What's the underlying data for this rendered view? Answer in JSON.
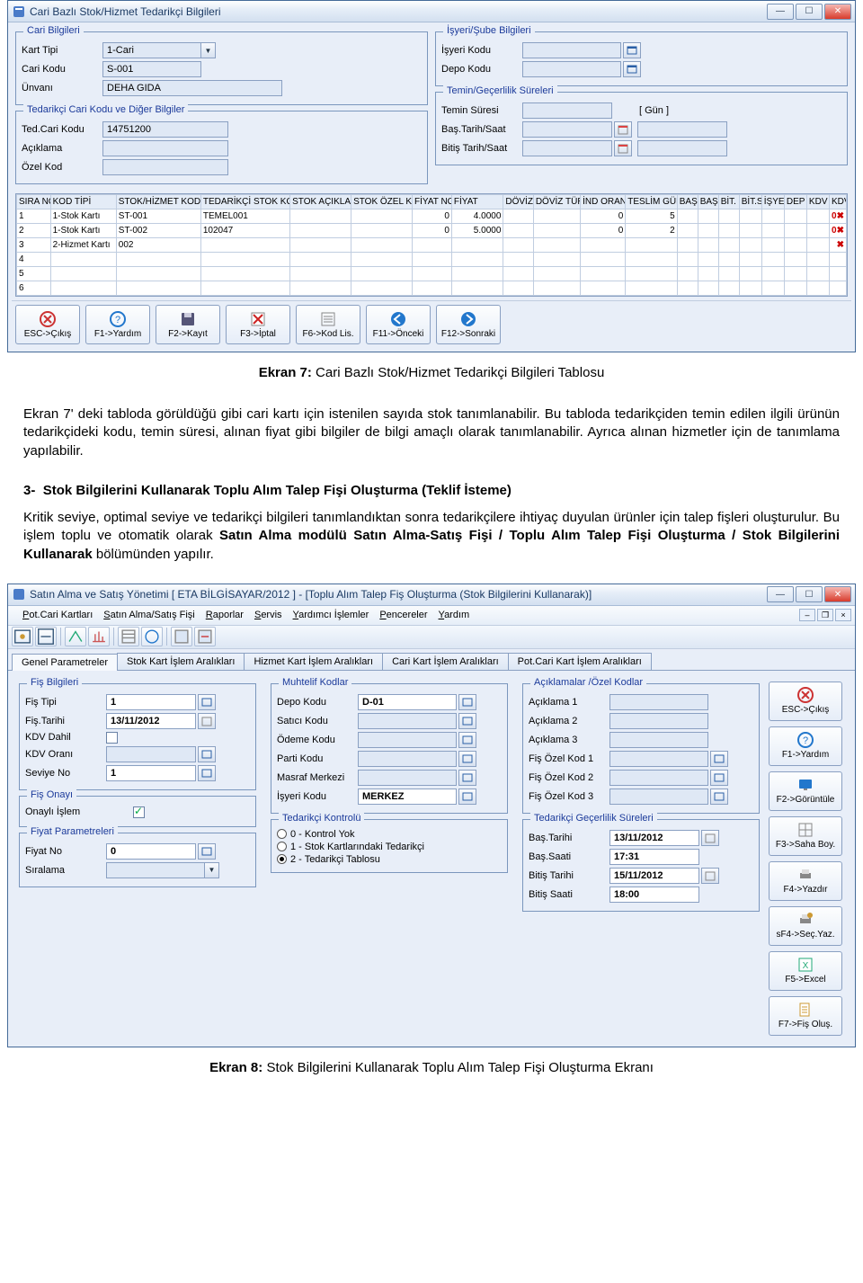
{
  "win1": {
    "title": "Cari Bazlı Stok/Hizmet Tedarikçi Bilgileri",
    "cari": {
      "legend": "Cari Bilgileri",
      "kart_tipi_lbl": "Kart Tipi",
      "kart_tipi_val": "1-Cari",
      "cari_kodu_lbl": "Cari Kodu",
      "cari_kodu_val": "S-001",
      "unvan_lbl": "Ünvanı",
      "unvan_val": "DEHA GIDA"
    },
    "tedarikci": {
      "legend": "Tedarikçi Cari Kodu ve Diğer Bilgiler",
      "ted_kodu_lbl": "Ted.Cari Kodu",
      "ted_kodu_val": "14751200",
      "aciklama_lbl": "Açıklama",
      "aciklama_val": "",
      "ozel_kod_lbl": "Özel Kod",
      "ozel_kod_val": ""
    },
    "isyeri": {
      "legend": "İşyeri/Şube Bilgileri",
      "isyeri_lbl": "İşyeri Kodu",
      "depo_lbl": "Depo Kodu"
    },
    "sureler": {
      "legend": "Temin/Geçerlilik Süreleri",
      "temin_lbl": "Temin Süresi",
      "gun_lbl": "[ Gün ]",
      "bas_lbl": "Baş.Tarih/Saat",
      "bit_lbl": "Bitiş Tarih/Saat"
    },
    "grid": {
      "headers": [
        "SIRA NO",
        "KOD TİPİ",
        "STOK/HİZMET KODU",
        "TEDARİKÇİ STOK KODU",
        "STOK AÇIKLAMA",
        "STOK ÖZEL KOD",
        "FİYAT NO",
        "FİYAT",
        "DÖVİZ",
        "DÖVİZ TÜRÜ",
        "İND ORANI",
        "TESLİM GÜNÜ",
        "BAŞ",
        "BAŞ",
        "BİT.",
        "BİT.S",
        "İŞYE",
        "DEP",
        "KDV",
        "KDV"
      ],
      "rows": [
        {
          "sira": "1",
          "kod_tipi": "1-Stok Kartı",
          "stok_kodu": "ST-001",
          "ted_stok": "TEMEL001",
          "fiyat_no": "0",
          "fiyat": "4.0000",
          "ind": "0",
          "teslim": "5",
          "kdv": "0"
        },
        {
          "sira": "2",
          "kod_tipi": "1-Stok Kartı",
          "stok_kodu": "ST-002",
          "ted_stok": "102047",
          "fiyat_no": "0",
          "fiyat": "5.0000",
          "ind": "0",
          "teslim": "2",
          "kdv": "0"
        },
        {
          "sira": "3",
          "kod_tipi": "2-Hizmet Kartı",
          "stok_kodu": "002",
          "ted_stok": "",
          "fiyat_no": "",
          "fiyat": "",
          "ind": "",
          "teslim": "",
          "kdv": ""
        },
        {
          "sira": "4",
          "kod_tipi": "",
          "stok_kodu": "",
          "ted_stok": "",
          "fiyat_no": "",
          "fiyat": "",
          "ind": "",
          "teslim": "",
          "kdv": ""
        },
        {
          "sira": "5",
          "kod_tipi": "",
          "stok_kodu": "",
          "ted_stok": "",
          "fiyat_no": "",
          "fiyat": "",
          "ind": "",
          "teslim": "",
          "kdv": ""
        },
        {
          "sira": "6",
          "kod_tipi": "",
          "stok_kodu": "",
          "ted_stok": "",
          "fiyat_no": "",
          "fiyat": "",
          "ind": "",
          "teslim": "",
          "kdv": ""
        }
      ]
    },
    "buttons": {
      "esc": "ESC->Çıkış",
      "f1": "F1->Yardım",
      "f2": "F2->Kayıt",
      "f3": "F3->İptal",
      "f6": "F6->Kod Lis.",
      "f11": "F11->Önceki",
      "f12": "F12->Sonraki"
    }
  },
  "doc": {
    "cap1_prefix": "Ekran 7:",
    "cap1_rest": " Cari Bazlı Stok/Hizmet Tedarikçi Bilgileri Tablosu",
    "p1": "Ekran 7' deki tabloda görüldüğü gibi cari kartı için istenilen sayıda stok tanımlanabilir. Bu tabloda tedarikçiden temin edilen ilgili ürünün tedarikçideki kodu, temin süresi, alınan fiyat gibi bilgiler de bilgi amaçlı olarak tanımlanabilir. Ayrıca alınan hizmetler için de tanımlama yapılabilir.",
    "h3_num": "3-",
    "h3_title": "Stok Bilgilerini Kullanarak Toplu Alım Talep Fişi Oluşturma (Teklif İsteme)",
    "p2a": "Kritik seviye, optimal seviye ve tedarikçi bilgileri tanımlandıktan sonra tedarikçilere ihtiyaç duyulan ürünler için talep fişleri oluşturulur. Bu işlem toplu ve otomatik olarak ",
    "p2b": "Satın Alma modülü Satın Alma-Satış Fişi / Toplu Alım Talep Fişi Oluşturma / Stok Bilgilerini Kullanarak",
    "p2c": " bölümünden yapılır.",
    "cap2_prefix": "Ekran 8:",
    "cap2_rest": " Stok Bilgilerini Kullanarak Toplu Alım Talep Fişi Oluşturma Ekranı"
  },
  "win2": {
    "title": "Satın Alma ve Satış Yönetimi [ ETA BİLGİSAYAR/2012 ]  -  [Toplu Alım Talep Fiş Oluşturma (Stok Bilgilerini Kullanarak)]",
    "menu": [
      "Pot.Cari Kartları",
      "Satın Alma/Satış Fişi",
      "Raporlar",
      "Servis",
      "Yardımcı İşlemler",
      "Pencereler",
      "Yardım"
    ],
    "tabs": [
      "Genel Parametreler",
      "Stok Kart İşlem Aralıkları",
      "Hizmet Kart İşlem Aralıkları",
      "Cari Kart İşlem Aralıkları",
      "Pot.Cari Kart İşlem Aralıkları"
    ],
    "fis": {
      "legend": "Fiş Bilgileri",
      "tip_lbl": "Fiş Tipi",
      "tip_val": "1",
      "tarih_lbl": "Fiş.Tarihi",
      "tarih_val": "13/11/2012",
      "kdv_dahil_lbl": "KDV Dahil",
      "kdv_oran_lbl": "KDV Oranı",
      "kdv_oran_val": "",
      "seviye_lbl": "Seviye No",
      "seviye_val": "1"
    },
    "onay": {
      "legend": "Fiş Onayı",
      "lbl": "Onaylı İşlem"
    },
    "fiyat": {
      "legend": "Fiyat Parametreleri",
      "no_lbl": "Fiyat No",
      "no_val": "0",
      "sira_lbl": "Sıralama"
    },
    "muhtelif": {
      "legend": "Muhtelif Kodlar",
      "depo_lbl": "Depo Kodu",
      "depo_val": "D-01",
      "satici_lbl": "Satıcı Kodu",
      "odeme_lbl": "Ödeme Kodu",
      "parti_lbl": "Parti Kodu",
      "masraf_lbl": "Masraf Merkezi",
      "isyeri_lbl": "İşyeri Kodu",
      "isyeri_val": "MERKEZ"
    },
    "tedkontrol": {
      "legend": "Tedarikçi Kontrolü",
      "r0": "0 - Kontrol Yok",
      "r1": "1 - Stok Kartlarındaki Tedarikçi",
      "r2": "2 - Tedarikçi Tablosu"
    },
    "acik": {
      "legend": "Açıklamalar /Özel Kodlar",
      "a1": "Açıklama 1",
      "a2": "Açıklama 2",
      "a3": "Açıklama 3",
      "k1": "Fiş Özel Kod 1",
      "k2": "Fiş Özel Kod 2",
      "k3": "Fiş Özel Kod 3"
    },
    "gecer": {
      "legend": "Tedarikçi Geçerlilik Süreleri",
      "bt_lbl": "Baş.Tarihi",
      "bt_val": "13/11/2012",
      "bs_lbl": "Baş.Saati",
      "bs_val": "17:31",
      "et_lbl": "Bitiş Tarihi",
      "et_val": "15/11/2012",
      "es_lbl": "Bitiş Saati",
      "es_val": "18:00"
    },
    "side": {
      "esc": "ESC->Çıkış",
      "f1": "F1->Yardım",
      "f2": "F2->Görüntüle",
      "f3": "F3->Saha Boy.",
      "f4": "F4->Yazdır",
      "sf4": "sF4->Seç.Yaz.",
      "f5": "F5->Excel",
      "f7": "F7->Fiş Oluş."
    }
  }
}
